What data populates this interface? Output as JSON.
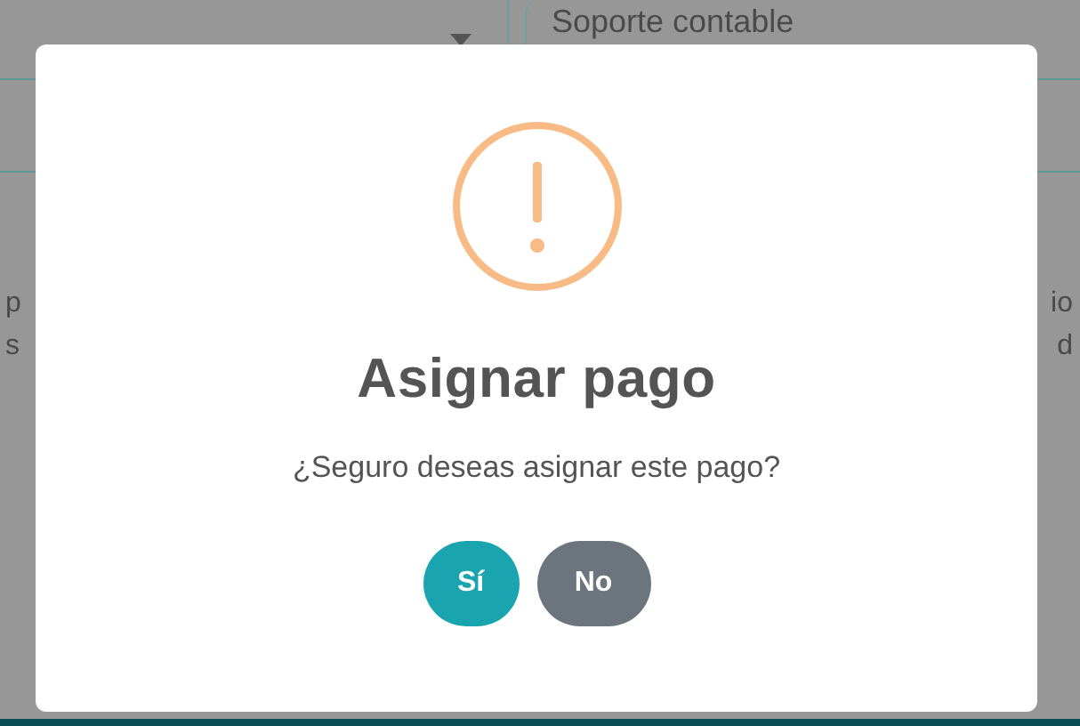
{
  "background": {
    "select_field": {
      "has_caret": true
    },
    "text_field": {
      "value": "Soporte contable"
    },
    "left_fragments": [
      "p",
      "s"
    ],
    "right_fragments": [
      "io",
      "d"
    ]
  },
  "dialog": {
    "kind": "warning",
    "title": "Asignar pago",
    "message": "¿Seguro deseas asignar este pago?",
    "buttons": [
      {
        "label": "Sí",
        "kind": "confirm"
      },
      {
        "label": "No",
        "kind": "cancel"
      }
    ]
  }
}
